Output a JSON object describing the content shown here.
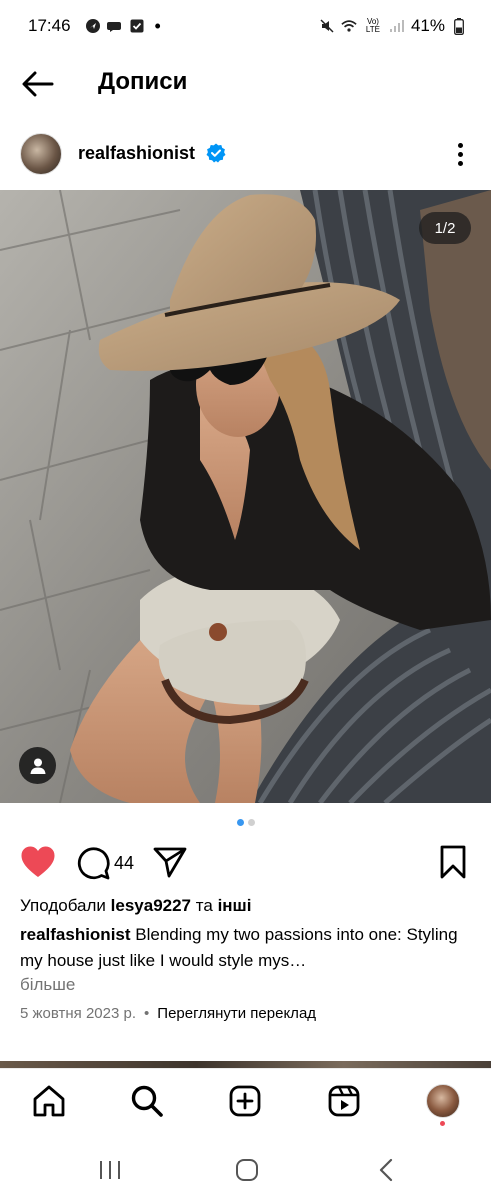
{
  "status_bar": {
    "time": "17:46",
    "notif_dot": "•",
    "battery": "41%",
    "network_label": "Vo) LTE"
  },
  "header": {
    "title": "Дописи",
    "back_icon": "arrow-left-icon"
  },
  "post": {
    "username": "realfashionist",
    "verified": true,
    "media_counter": "1/2",
    "carousel_index": 0,
    "carousel_total": 2,
    "liked": true,
    "comment_count": "44",
    "likes": {
      "prefix": "Уподобали",
      "user": "lesya9227",
      "conjunction": "та",
      "others": "інші"
    },
    "caption": {
      "author": "realfashionist",
      "text": "Blending my two passions into one: Styling my house just like I would style mys…"
    },
    "more_label": "більше",
    "date": "5 жовтня 2023 р.",
    "separator": "•",
    "translate_label": "Переглянути переклад"
  },
  "colors": {
    "like_red": "#ed4956",
    "verified_blue": "#0095f6",
    "muted_text": "#737373",
    "dot_active": "#3897f0"
  },
  "bottom_nav": [
    "home-icon",
    "search-icon",
    "create-icon",
    "reels-icon",
    "profile-avatar"
  ],
  "system_nav": [
    "recents-icon",
    "home-circle-icon",
    "back-chevron-icon"
  ]
}
